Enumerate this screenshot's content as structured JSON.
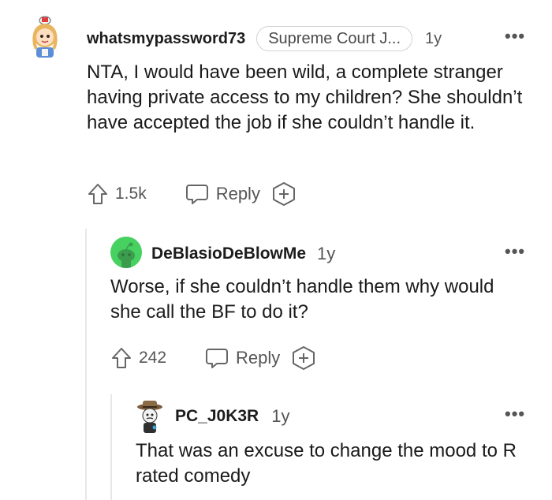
{
  "comments": [
    {
      "username": "whatsmypassword73",
      "flair": "Supreme Court J...",
      "time": "1y",
      "more": "•••",
      "body": "NTA, I would have been wild, a complete stranger having private access to my children? She shouldn’t have accepted the job if she couldn’t handle it.",
      "upvotes": "1.5k",
      "reply_label": "Reply"
    },
    {
      "username": "DeBlasioDeBlowMe",
      "time": "1y",
      "more": "•••",
      "body": "Worse, if she couldn’t handle them why would she call the BF to do it?",
      "upvotes": "242",
      "reply_label": "Reply"
    },
    {
      "username": "PC_J0K3R",
      "time": "1y",
      "more": "•••",
      "body": "That was an excuse to change the mood to R rated comedy"
    }
  ],
  "colors": {
    "avatar_green": "#46d160",
    "text": "#1a1a1b",
    "muted": "#555555",
    "thread_line": "#e5e7ea"
  }
}
